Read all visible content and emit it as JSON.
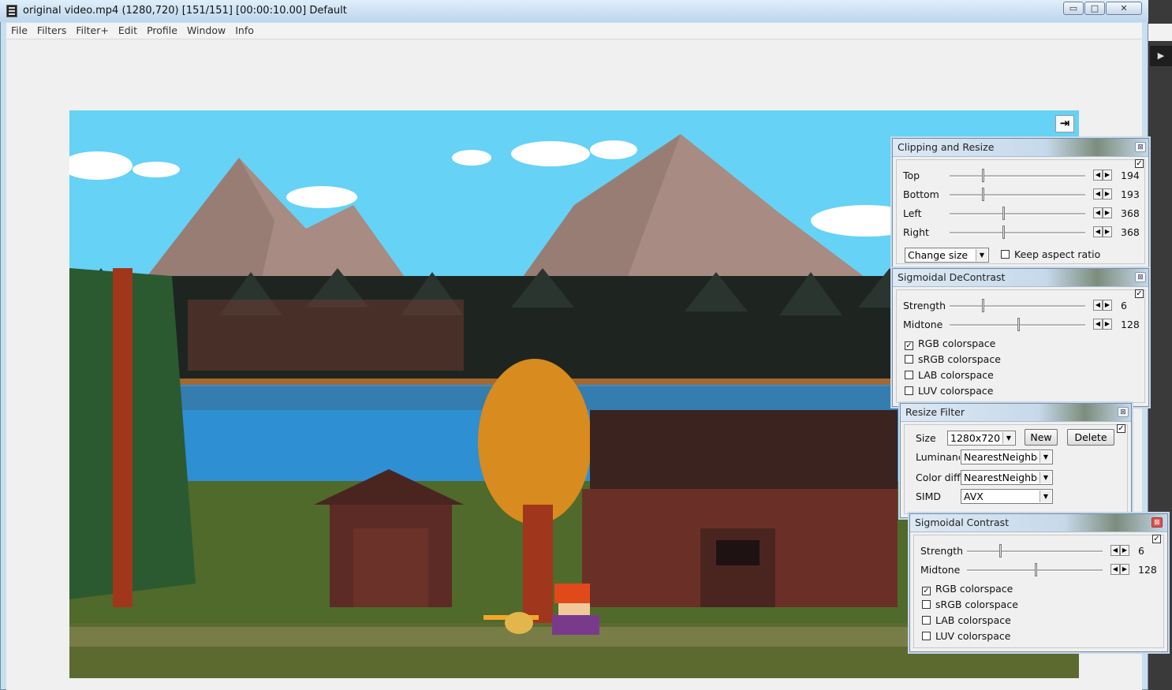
{
  "window": {
    "title": "original video.mp4 (1280,720)  [151/151] [00:00:10.00]  Default",
    "minimize": "▭",
    "maximize": "□",
    "close": "✕"
  },
  "menu": [
    "File",
    "Filters",
    "Filter+",
    "Edit",
    "Profile",
    "Window",
    "Info"
  ],
  "video": {
    "collapse_icon": "⇥"
  },
  "clipping": {
    "title": "Clipping and Resize",
    "enabled": true,
    "rows": [
      {
        "label": "Top",
        "value": "194",
        "fraction": 0.24
      },
      {
        "label": "Bottom",
        "value": "193",
        "fraction": 0.24
      },
      {
        "label": "Left",
        "value": "368",
        "fraction": 0.39
      },
      {
        "label": "Right",
        "value": "368",
        "fraction": 0.39
      }
    ],
    "mode": "Change size",
    "keep_aspect": {
      "label": "Keep aspect ratio",
      "checked": false
    }
  },
  "decontrast": {
    "title": "Sigmoidal DeContrast",
    "enabled": true,
    "rows": [
      {
        "label": "Strength",
        "value": "6",
        "fraction": 0.24
      },
      {
        "label": "Midtone",
        "value": "128",
        "fraction": 0.5
      }
    ],
    "checks": [
      {
        "label": "RGB colorspace",
        "checked": true
      },
      {
        "label": "sRGB colorspace",
        "checked": false
      },
      {
        "label": "LAB colorspace",
        "checked": false
      },
      {
        "label": "LUV colorspace",
        "checked": false
      }
    ]
  },
  "resize": {
    "title": "Resize Filter",
    "enabled": true,
    "size_label": "Size",
    "size_value": "1280x720",
    "new_label": "New",
    "delete_label": "Delete",
    "lum_label": "Luminance",
    "lum_value": "NearestNeighbor",
    "color_label": "Color diff",
    "color_value": "NearestNeighbor",
    "simd_label": "SIMD",
    "simd_value": "AVX"
  },
  "contrast": {
    "title": "Sigmoidal Contrast",
    "enabled": true,
    "rows": [
      {
        "label": "Strength",
        "value": "6",
        "fraction": 0.24
      },
      {
        "label": "Midtone",
        "value": "128",
        "fraction": 0.5
      }
    ],
    "checks": [
      {
        "label": "RGB colorspace",
        "checked": true
      },
      {
        "label": "sRGB colorspace",
        "checked": false
      },
      {
        "label": "LAB colorspace",
        "checked": false
      },
      {
        "label": "LUV colorspace",
        "checked": false
      }
    ]
  }
}
